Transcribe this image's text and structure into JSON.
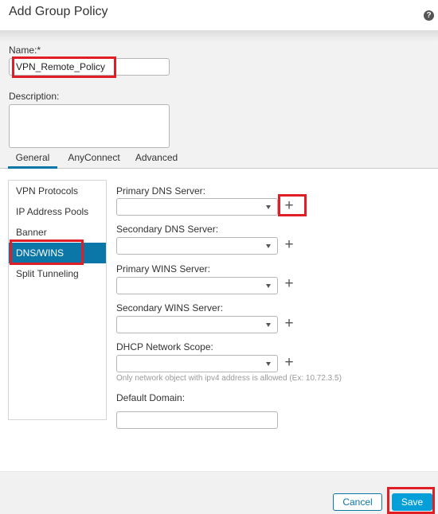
{
  "dialog": {
    "title": "Add Group Policy",
    "help_icon": "question-circle-icon"
  },
  "form": {
    "name_label": "Name:*",
    "name_value": "VPN_Remote_Policy",
    "description_label": "Description:",
    "description_value": ""
  },
  "tabs": [
    {
      "label": "General",
      "active": true
    },
    {
      "label": "AnyConnect",
      "active": false
    },
    {
      "label": "Advanced",
      "active": false
    }
  ],
  "sidebar": {
    "items": [
      {
        "label": "VPN Protocols",
        "active": false
      },
      {
        "label": "IP Address Pools",
        "active": false
      },
      {
        "label": "Banner",
        "active": false
      },
      {
        "label": "DNS/WINS",
        "active": true
      },
      {
        "label": "Split Tunneling",
        "active": false
      }
    ]
  },
  "dns_wins": {
    "primary_dns_label": "Primary DNS Server:",
    "primary_dns_value": "",
    "secondary_dns_label": "Secondary DNS Server:",
    "secondary_dns_value": "",
    "primary_wins_label": "Primary WINS Server:",
    "primary_wins_value": "",
    "secondary_wins_label": "Secondary WINS Server:",
    "secondary_wins_value": "",
    "dhcp_scope_label": "DHCP Network Scope:",
    "dhcp_scope_value": "",
    "dhcp_hint": "Only network object with ipv4 address is allowed (Ex: 10.72.3.5)",
    "default_domain_label": "Default Domain:",
    "default_domain_value": "",
    "add_symbol": "+"
  },
  "footer": {
    "cancel_label": "Cancel",
    "save_label": "Save"
  },
  "colors": {
    "accent": "#0b76a8",
    "save_button": "#049fd9",
    "highlight": "#e01e26"
  }
}
